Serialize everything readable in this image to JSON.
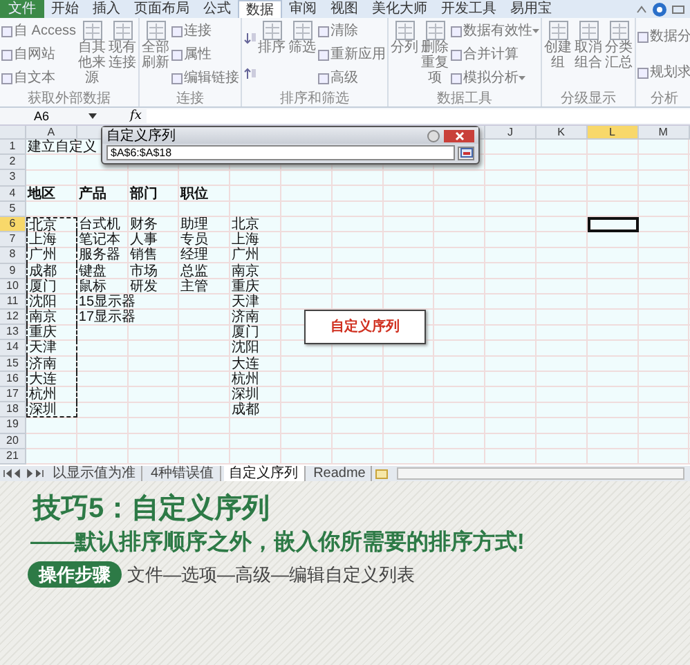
{
  "ribbon_tabs": [
    {
      "label": "文件",
      "kind": "file",
      "selected": false
    },
    {
      "label": "开始",
      "kind": "tab",
      "selected": false
    },
    {
      "label": "插入",
      "kind": "tab",
      "selected": false
    },
    {
      "label": "页面布局",
      "kind": "tab",
      "selected": false
    },
    {
      "label": "公式",
      "kind": "tab",
      "selected": false
    },
    {
      "label": "数据",
      "kind": "tab",
      "selected": true
    },
    {
      "label": "审阅",
      "kind": "tab",
      "selected": false
    },
    {
      "label": "视图",
      "kind": "tab",
      "selected": false
    },
    {
      "label": "美化大师",
      "kind": "tab",
      "selected": false
    },
    {
      "label": "开发工具",
      "kind": "tab",
      "selected": false
    },
    {
      "label": "易用宝",
      "kind": "tab",
      "selected": false
    }
  ],
  "ribbon_groups": [
    {
      "label": "获取外部数据",
      "items": [
        {
          "kind": "small",
          "text": "自 Access"
        },
        {
          "kind": "small",
          "text": "自网站"
        },
        {
          "kind": "small",
          "text": "自文本"
        },
        {
          "kind": "big",
          "text": "自其他来源"
        },
        {
          "kind": "big",
          "text": "现有连接"
        }
      ]
    },
    {
      "label": "连接",
      "items": [
        {
          "kind": "big",
          "text": "全部刷新"
        },
        {
          "kind": "small",
          "text": "连接"
        },
        {
          "kind": "small",
          "text": "属性"
        },
        {
          "kind": "small",
          "text": "编辑链接"
        }
      ]
    },
    {
      "label": "排序和筛选",
      "items": [
        {
          "kind": "sort"
        },
        {
          "kind": "big",
          "text": "排序"
        },
        {
          "kind": "big",
          "text": "筛选"
        },
        {
          "kind": "small",
          "text": "清除"
        },
        {
          "kind": "small",
          "text": "重新应用"
        },
        {
          "kind": "small",
          "text": "高级"
        }
      ]
    },
    {
      "label": "数据工具",
      "items": [
        {
          "kind": "big",
          "text": "分列"
        },
        {
          "kind": "big",
          "text": "删除重复项"
        },
        {
          "kind": "small",
          "text": "数据有效性",
          "dropdown": true
        },
        {
          "kind": "small",
          "text": "合并计算"
        },
        {
          "kind": "small",
          "text": "模拟分析",
          "dropdown": true
        }
      ]
    },
    {
      "label": "分级显示",
      "items": [
        {
          "kind": "big",
          "text": "创建组"
        },
        {
          "kind": "big",
          "text": "取消组合"
        },
        {
          "kind": "big",
          "text": "分类汇总"
        }
      ]
    },
    {
      "label": "分析",
      "items": [
        {
          "kind": "small",
          "text": "数据分"
        },
        {
          "kind": "small",
          "text": "规划求"
        }
      ]
    }
  ],
  "formula_bar": {
    "name_box": "A6",
    "function_label": "fx"
  },
  "dialog": {
    "title": "自定义序列",
    "value": "$A$6:$A$18"
  },
  "column_headers": [
    {
      "label": "A",
      "selected": false
    },
    {
      "label": "J",
      "selected": false
    },
    {
      "label": "K",
      "selected": false
    },
    {
      "label": "L",
      "selected": true
    },
    {
      "label": "M",
      "selected": false
    }
  ],
  "rows": [
    {
      "num": "1",
      "selected": false,
      "copied": false,
      "cells": {
        "A": "建立自定义"
      }
    },
    {
      "num": "2",
      "selected": false,
      "copied": false,
      "cells": {}
    },
    {
      "num": "3",
      "selected": false,
      "copied": false,
      "cells": {}
    },
    {
      "num": "4",
      "selected": false,
      "copied": false,
      "cells": {
        "A": "地区",
        "B": "产品",
        "C": "部门",
        "D": "职位"
      }
    },
    {
      "num": "5",
      "selected": false,
      "copied": false,
      "cells": {}
    },
    {
      "num": "6",
      "selected": true,
      "copied": true,
      "cells": {
        "A": "北京",
        "B": "台式机",
        "C": "财务",
        "D": "助理",
        "E": "北京"
      }
    },
    {
      "num": "7",
      "selected": false,
      "copied": true,
      "cells": {
        "A": "上海",
        "B": "笔记本",
        "C": "人事",
        "D": "专员",
        "E": "上海"
      }
    },
    {
      "num": "8",
      "selected": false,
      "copied": true,
      "cells": {
        "A": "广州",
        "B": "服务器",
        "C": "销售",
        "D": "经理",
        "E": "广州"
      }
    },
    {
      "num": "9",
      "selected": false,
      "copied": true,
      "cells": {
        "A": "成都",
        "B": "键盘",
        "C": "市场",
        "D": "总监",
        "E": "南京"
      }
    },
    {
      "num": "10",
      "selected": false,
      "copied": true,
      "cells": {
        "A": "厦门",
        "B": "鼠标",
        "C": "研发",
        "D": "主管",
        "E": "重庆"
      }
    },
    {
      "num": "11",
      "selected": false,
      "copied": true,
      "cells": {
        "A": "沈阳",
        "B": "15显示器",
        "E": "天津"
      }
    },
    {
      "num": "12",
      "selected": false,
      "copied": true,
      "cells": {
        "A": "南京",
        "B": "17显示器",
        "E": "济南"
      }
    },
    {
      "num": "13",
      "selected": false,
      "copied": true,
      "cells": {
        "A": "重庆",
        "E": "厦门"
      }
    },
    {
      "num": "14",
      "selected": false,
      "copied": true,
      "cells": {
        "A": "天津",
        "E": "沈阳"
      }
    },
    {
      "num": "15",
      "selected": false,
      "copied": true,
      "cells": {
        "A": "济南",
        "E": "大连"
      }
    },
    {
      "num": "16",
      "selected": false,
      "copied": true,
      "cells": {
        "A": "大连",
        "E": "杭州"
      }
    },
    {
      "num": "17",
      "selected": false,
      "copied": true,
      "cells": {
        "A": "杭州",
        "E": "深圳"
      }
    },
    {
      "num": "18",
      "selected": false,
      "copied": true,
      "cells": {
        "A": "深圳",
        "E": "成都"
      }
    },
    {
      "num": "19",
      "selected": false,
      "copied": false,
      "cells": {}
    },
    {
      "num": "20",
      "selected": false,
      "copied": false,
      "cells": {}
    },
    {
      "num": "21",
      "selected": false,
      "copied": false,
      "cells": {}
    }
  ],
  "text_box": "自定义序列",
  "sheet_tabs": [
    {
      "label": "以显示值为准",
      "selected": false
    },
    {
      "label": "4种错误值",
      "selected": false
    },
    {
      "label": "自定义序列",
      "selected": true
    },
    {
      "label": "Readme",
      "selected": false
    }
  ],
  "caption": {
    "title": "技巧5：自定义序列",
    "subtitle": "——默认排序顺序之外，嵌入你所需要的排序方式!",
    "steps_badge": "操作步骤",
    "steps": "文件—选项—高级—编辑自定义列表"
  }
}
